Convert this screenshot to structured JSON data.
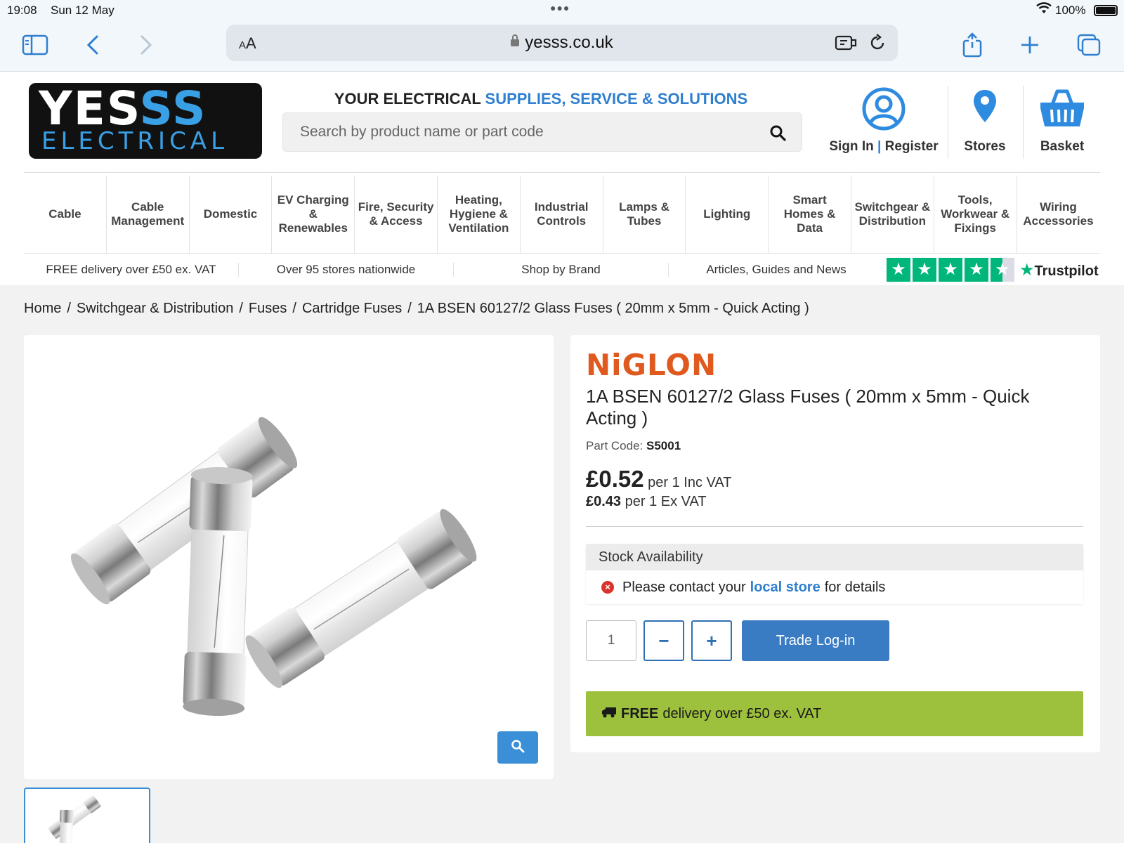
{
  "status": {
    "time": "19:08",
    "date": "Sun 12 May",
    "battery": "100%"
  },
  "browser": {
    "aa_small": "A",
    "aa_big": "A",
    "url": "yesss.co.uk"
  },
  "logo": {
    "line1_white": "YES",
    "line1_blue": "SS",
    "line2": "ELECTRICAL"
  },
  "header": {
    "tagline_dark": "YOUR ELECTRICAL ",
    "tagline_blue": "SUPPLIES, SERVICE & SOLUTIONS",
    "search_placeholder": "Search by product name or part code",
    "sign_in": "Sign In",
    "divider": "|",
    "register": "Register",
    "stores": "Stores",
    "basket": "Basket"
  },
  "nav": [
    "Cable",
    "Cable Management",
    "Domestic",
    "EV Charging & Renewables",
    "Fire, Security & Access",
    "Heating, Hygiene & Ventilation",
    "Industrial Controls",
    "Lamps & Tubes",
    "Lighting",
    "Smart Homes & Data",
    "Switchgear & Distribution",
    "Tools, Workwear & Fixings",
    "Wiring Accessories"
  ],
  "promos": [
    "FREE delivery over £50 ex. VAT",
    "Over 95 stores nationwide",
    "Shop by Brand",
    "Articles, Guides and News"
  ],
  "trustpilot": {
    "label": "Trustpilot",
    "rating_stars": 4.5
  },
  "breadcrumb": [
    "Home",
    "Switchgear & Distribution",
    "Fuses",
    "Cartridge Fuses",
    "1A BSEN 60127/2 Glass Fuses ( 20mm x 5mm - Quick Acting )"
  ],
  "product": {
    "brand": "NiGLON",
    "title": "1A BSEN 60127/2 Glass Fuses ( 20mm x 5mm - Quick Acting )",
    "part_code_label": "Part Code:",
    "part_code": "S5001",
    "price_inc": "£0.52",
    "price_inc_suffix": "per 1 Inc VAT",
    "price_ex": "£0.43",
    "price_ex_suffix": "per 1 Ex VAT",
    "stock_heading": "Stock Availability",
    "stock_pre": "Please contact your",
    "stock_link": "local store",
    "stock_post": "for details",
    "quantity": "1",
    "minus": "−",
    "plus": "+",
    "trade_button": "Trade Log-in",
    "delivery_bold": "FREE",
    "delivery_rest": "delivery over £50 ex. VAT"
  }
}
